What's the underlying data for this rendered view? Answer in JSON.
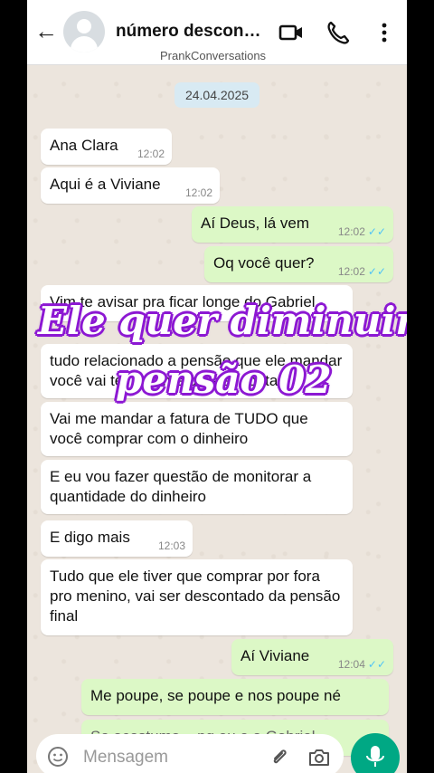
{
  "header": {
    "title": "número descon…",
    "subtitle": "PrankConversations",
    "icons": [
      "back-arrow-icon",
      "avatar-icon",
      "video-call-icon",
      "phone-call-icon",
      "more-vertical-icon"
    ]
  },
  "date_chip": "24.04.2025",
  "messages": [
    {
      "text": "Ana Clara",
      "time": "12:02",
      "direction": "incoming"
    },
    {
      "text": "Aqui é a Viviane",
      "time": "12:02",
      "direction": "incoming"
    },
    {
      "text": "Aí Deus, lá vem",
      "time": "12:02",
      "direction": "outgoing"
    },
    {
      "text": "Oq você quer?",
      "time": "12:02",
      "direction": "outgoing"
    },
    {
      "text": "Vim te avisar pra ficar longe do Gabriel",
      "direction": "incoming"
    },
    {
      "text": "tudo relacionado a pensão que ele mandar você vai ter que me prestar contas",
      "direction": "incoming"
    },
    {
      "text": "Vai me mandar a fatura de TUDO que você comprar com o dinheiro",
      "direction": "incoming"
    },
    {
      "text": "E eu vou fazer questão de monitorar a quantidade do dinheiro",
      "direction": "incoming"
    },
    {
      "text": "E digo mais",
      "time": "12:03",
      "direction": "incoming"
    },
    {
      "text": "Tudo que ele tiver que comprar por fora pro menino, vai ser descontado da pensão final",
      "direction": "incoming"
    },
    {
      "text": "Aí Viviane",
      "time": "12:04",
      "direction": "outgoing"
    },
    {
      "text": "Me poupe, se poupe e nos poupe né",
      "direction": "outgoing"
    },
    {
      "text": "Se acostuma... pq eu e o Gabriel...",
      "direction": "outgoing"
    }
  ],
  "overlay": {
    "line1": "Ele quer diminuir a",
    "line2": "pensão  02"
  },
  "composer": {
    "placeholder": "Mensagem"
  },
  "colors": {
    "chat_background": "#ece5dd",
    "incoming_bubble": "#ffffff",
    "outgoing_bubble": "#dcf8c6",
    "mic_button": "#00a884",
    "overlay_text_stroke": "#8d19d3"
  }
}
